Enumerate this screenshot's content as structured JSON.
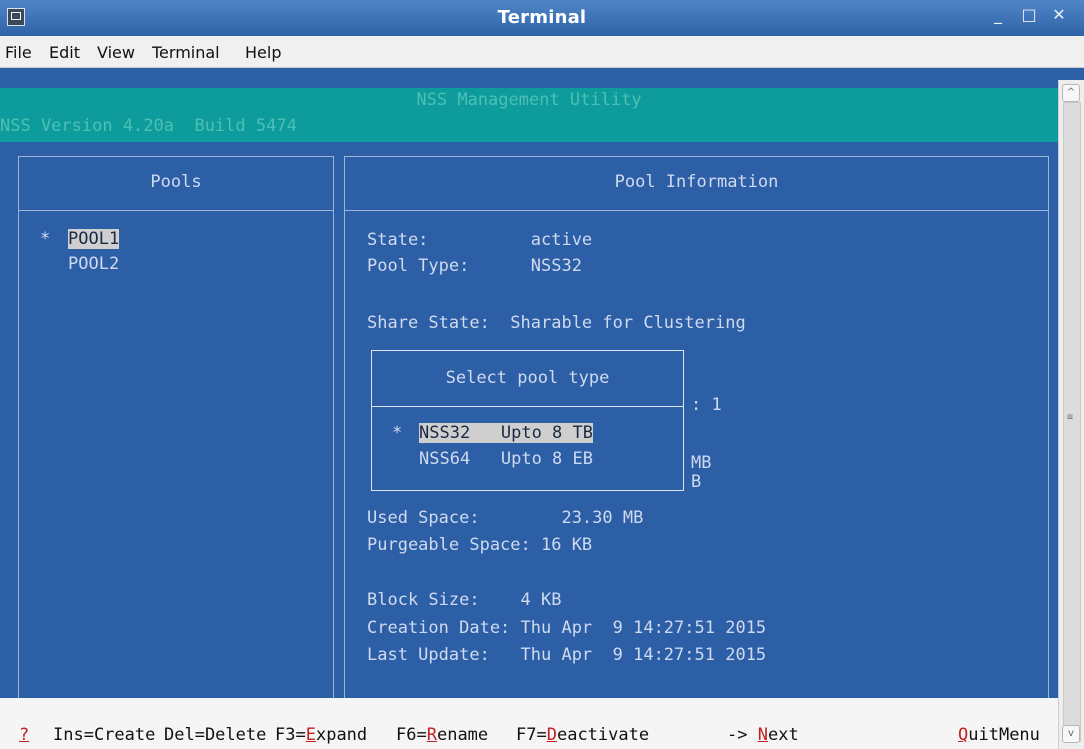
{
  "window": {
    "title": "Terminal",
    "controls": [
      "_",
      "□",
      "✕"
    ]
  },
  "menubar": [
    "File",
    "Edit",
    "View",
    "Terminal",
    "Help"
  ],
  "header": {
    "title": "NSS Management Utility",
    "version": "NSS Version 4.20a  Build 5474"
  },
  "pools_panel": {
    "title": "Pools",
    "items": [
      {
        "marker": "*",
        "name": "POOL1"
      },
      {
        "marker": "",
        "name": "POOL2"
      }
    ]
  },
  "info_panel": {
    "title": "Pool Information",
    "state": "State:          active",
    "pool_type": "Pool Type:      NSS32",
    "share_state": "Share State:  Sharable for Clustering",
    "partial_1": ": 1",
    "partial_2": "MB",
    "partial_3": "B",
    "used_space": "Used Space:        23.30 MB",
    "purgeable_space": "Purgeable Space: 16 KB",
    "block_size": "Block Size:    4 KB",
    "creation_date": "Creation Date: Thu Apr  9 14:27:51 2015",
    "last_update": "Last Update:   Thu Apr  9 14:27:51 2015"
  },
  "dialog": {
    "title": "Select pool type",
    "options": [
      {
        "marker": "*",
        "label": "NSS32   Upto 8 TB"
      },
      {
        "marker": "",
        "label": "NSS64   Upto 8 EB"
      }
    ]
  },
  "fkeys": [
    {
      "pre": "",
      "hot": "?",
      "post": ""
    },
    {
      "pre": "Ins=Create",
      "hot": "",
      "post": ""
    },
    {
      "pre": "Del=Delete",
      "hot": "",
      "post": ""
    },
    {
      "pre": "F3=",
      "hot": "E",
      "post": "xpand"
    },
    {
      "pre": "F6=",
      "hot": "R",
      "post": "ename"
    },
    {
      "pre": "F7=",
      "hot": "D",
      "post": "eactivate"
    },
    {
      "pre": "-> ",
      "hot": "N",
      "post": "ext"
    },
    {
      "pre": "",
      "hot": "Q",
      "post": "uitMenu"
    }
  ],
  "scrollbar": {
    "up": "^",
    "grip": "≡",
    "down": "v"
  }
}
